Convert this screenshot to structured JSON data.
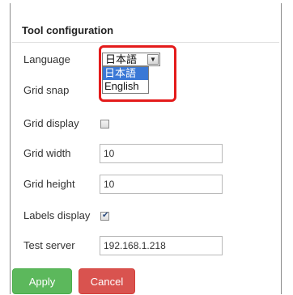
{
  "dialog": {
    "title": "Tool configuration"
  },
  "fields": {
    "language": {
      "label": "Language",
      "selected": "日本語"
    },
    "grid_snap": {
      "label": "Grid snap"
    },
    "grid_display": {
      "label": "Grid display",
      "checked": false
    },
    "grid_width": {
      "label": "Grid width",
      "value": "10"
    },
    "grid_height": {
      "label": "Grid height",
      "value": "10"
    },
    "labels_display": {
      "label": "Labels display",
      "checked": true
    },
    "test_server": {
      "label": "Test server",
      "value": "192.168.1.218"
    }
  },
  "language_dropdown": {
    "options": [
      "日本語",
      "English"
    ],
    "highlighted_index": 0
  },
  "buttons": {
    "apply_label": "Apply",
    "cancel_label": "Cancel"
  },
  "colors": {
    "highlight_border": "#e41b1b",
    "apply_button": "#5cb85c",
    "cancel_button": "#d9534f",
    "selected_option": "#3a78d6"
  },
  "icons": {
    "checkmark": "checkmark-icon",
    "dropdown_arrow": "chevron-down-icon"
  }
}
